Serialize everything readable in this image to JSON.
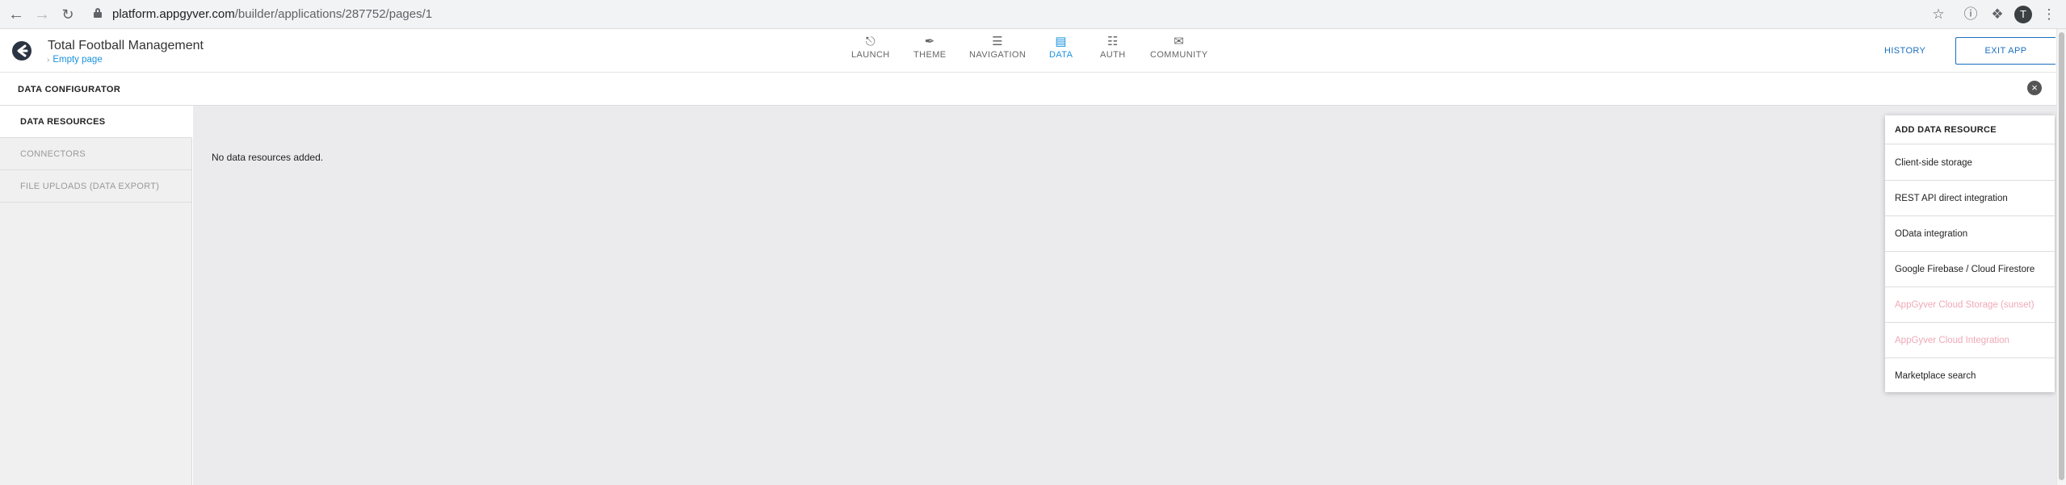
{
  "browser": {
    "url_host": "platform.appgyver.com",
    "url_path": "/builder/applications/287752/pages/1",
    "avatar_letter": "T"
  },
  "header": {
    "app_title": "Total Football Management",
    "breadcrumb": "Empty page",
    "tabs": [
      {
        "label": "LAUNCH",
        "icon": "upload-circle-icon"
      },
      {
        "label": "THEME",
        "icon": "brush-icon"
      },
      {
        "label": "NAVIGATION",
        "icon": "list-icon"
      },
      {
        "label": "DATA",
        "icon": "folder-icon",
        "active": true
      },
      {
        "label": "AUTH",
        "icon": "document-icon"
      },
      {
        "label": "COMMUNITY",
        "icon": "chat-icon"
      }
    ],
    "history_label": "HISTORY",
    "exit_label": "EXIT APP"
  },
  "config_bar": {
    "title": "DATA CONFIGURATOR"
  },
  "left_panel": {
    "items": [
      {
        "label": "DATA RESOURCES",
        "active": true
      },
      {
        "label": "CONNECTORS",
        "active": false
      },
      {
        "label": "FILE UPLOADS (DATA EXPORT)",
        "active": false
      }
    ]
  },
  "main": {
    "empty_message": "No data resources added."
  },
  "dropdown": {
    "header": "ADD DATA RESOURCE",
    "items": [
      {
        "label": "Client-side storage",
        "enabled": true
      },
      {
        "label": "REST API direct integration",
        "enabled": true
      },
      {
        "label": "OData integration",
        "enabled": true
      },
      {
        "label": "Google Firebase / Cloud Firestore",
        "enabled": true
      },
      {
        "label": "AppGyver Cloud Storage (sunset)",
        "enabled": false
      },
      {
        "label": "AppGyver Cloud Integration",
        "enabled": false
      },
      {
        "label": "Marketplace search",
        "enabled": true
      }
    ]
  },
  "colors": {
    "accent": "#1a93de",
    "exit_button": "#1a6fc0",
    "disabled_item": "#f0a8b6"
  }
}
